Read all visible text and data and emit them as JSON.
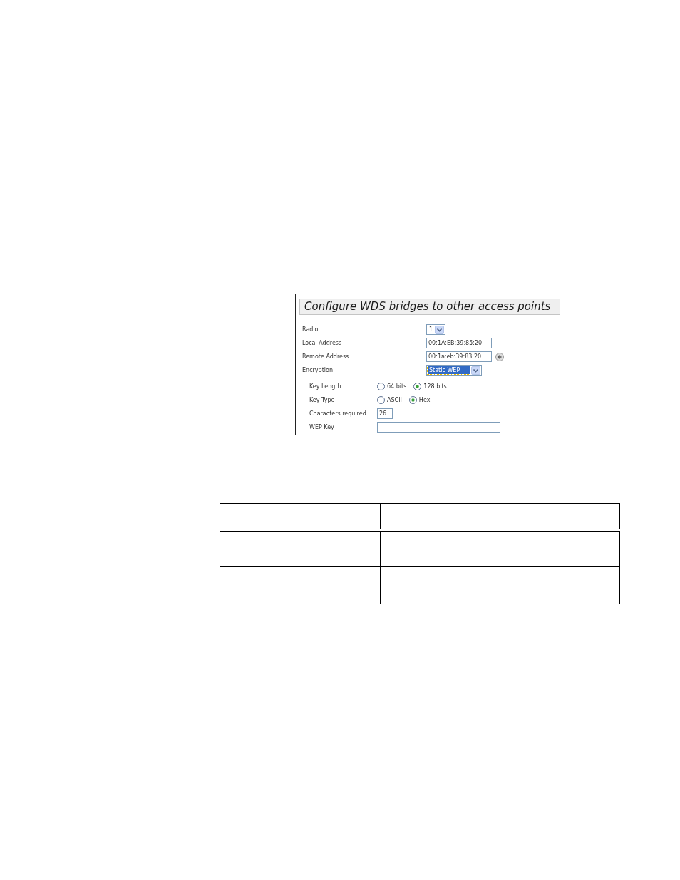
{
  "panel": {
    "title": "Configure WDS bridges to other access points",
    "fields": [
      {
        "kind": "select",
        "label": "Radio",
        "value": "1",
        "focused": false
      },
      {
        "kind": "address",
        "label": "Local Address",
        "value": "00:1A:EB:39:85:20",
        "has_button": false
      },
      {
        "kind": "address",
        "label": "Remote Address",
        "value": "00:1a:eb:39:83:20",
        "has_button": true
      },
      {
        "kind": "select",
        "label": "Encryption",
        "value": "Static WEP",
        "focused": true,
        "children": [
          {
            "kind": "radio",
            "label": "Key Length",
            "options": [
              {
                "label": "64 bits",
                "selected": false
              },
              {
                "label": "128 bits",
                "selected": true
              }
            ]
          },
          {
            "kind": "radio",
            "label": "Key Type",
            "options": [
              {
                "label": "ASCII",
                "selected": false
              },
              {
                "label": "Hex",
                "selected": true
              }
            ]
          },
          {
            "kind": "number",
            "label": "Characters required",
            "value": "26"
          },
          {
            "kind": "key",
            "label": "WEP Key"
          }
        ]
      }
    ]
  },
  "table": {
    "rows": [
      {
        "kind": "header"
      },
      {
        "kind": "body"
      },
      {
        "kind": "body"
      }
    ]
  }
}
